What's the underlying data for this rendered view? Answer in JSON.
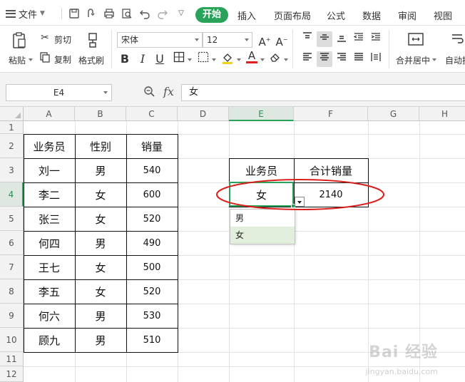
{
  "menubar": {
    "file_label": "文件",
    "tabs": [
      {
        "label": "开始",
        "active": true
      },
      {
        "label": "插入"
      },
      {
        "label": "页面布局"
      },
      {
        "label": "公式"
      },
      {
        "label": "数据"
      },
      {
        "label": "审阅"
      },
      {
        "label": "视图"
      }
    ]
  },
  "ribbon": {
    "paste_label": "粘贴",
    "cut_label": "剪切",
    "copy_label": "复制",
    "format_painter_label": "格式刷",
    "font_name": "宋体",
    "font_size": "12",
    "merge_center_label": "合并居中",
    "auto_wrap_label": "自动换"
  },
  "formula_bar": {
    "name_box": "E4",
    "fx_label": "fx",
    "formula": "女"
  },
  "grid": {
    "columns": [
      "A",
      "B",
      "C",
      "D",
      "E",
      "F",
      "G",
      "H"
    ],
    "rows": [
      "1",
      "2",
      "3",
      "4",
      "5",
      "6",
      "7",
      "8",
      "9",
      "10",
      "11",
      "12"
    ],
    "selected_col": "E",
    "selected_row": "4"
  },
  "table": {
    "headers": [
      "业务员",
      "性别",
      "销量"
    ],
    "rows": [
      [
        "刘一",
        "男",
        "540"
      ],
      [
        "李二",
        "女",
        "600"
      ],
      [
        "张三",
        "女",
        "520"
      ],
      [
        "何四",
        "男",
        "490"
      ],
      [
        "王七",
        "女",
        "500"
      ],
      [
        "李五",
        "女",
        "520"
      ],
      [
        "何六",
        "男",
        "530"
      ],
      [
        "顾九",
        "男",
        "510"
      ]
    ]
  },
  "summary": {
    "headers": [
      "业务员",
      "合计销量"
    ],
    "value_gender": "女",
    "value_total": "2140"
  },
  "dropdown": {
    "options": [
      "男",
      "女"
    ],
    "highlighted": "女"
  },
  "watermark": {
    "text": "Bai 经验",
    "sub": "jingyan.baidu.com"
  },
  "colors": {
    "accent": "#2aa35a",
    "annotation_ring": "#d9201b"
  }
}
